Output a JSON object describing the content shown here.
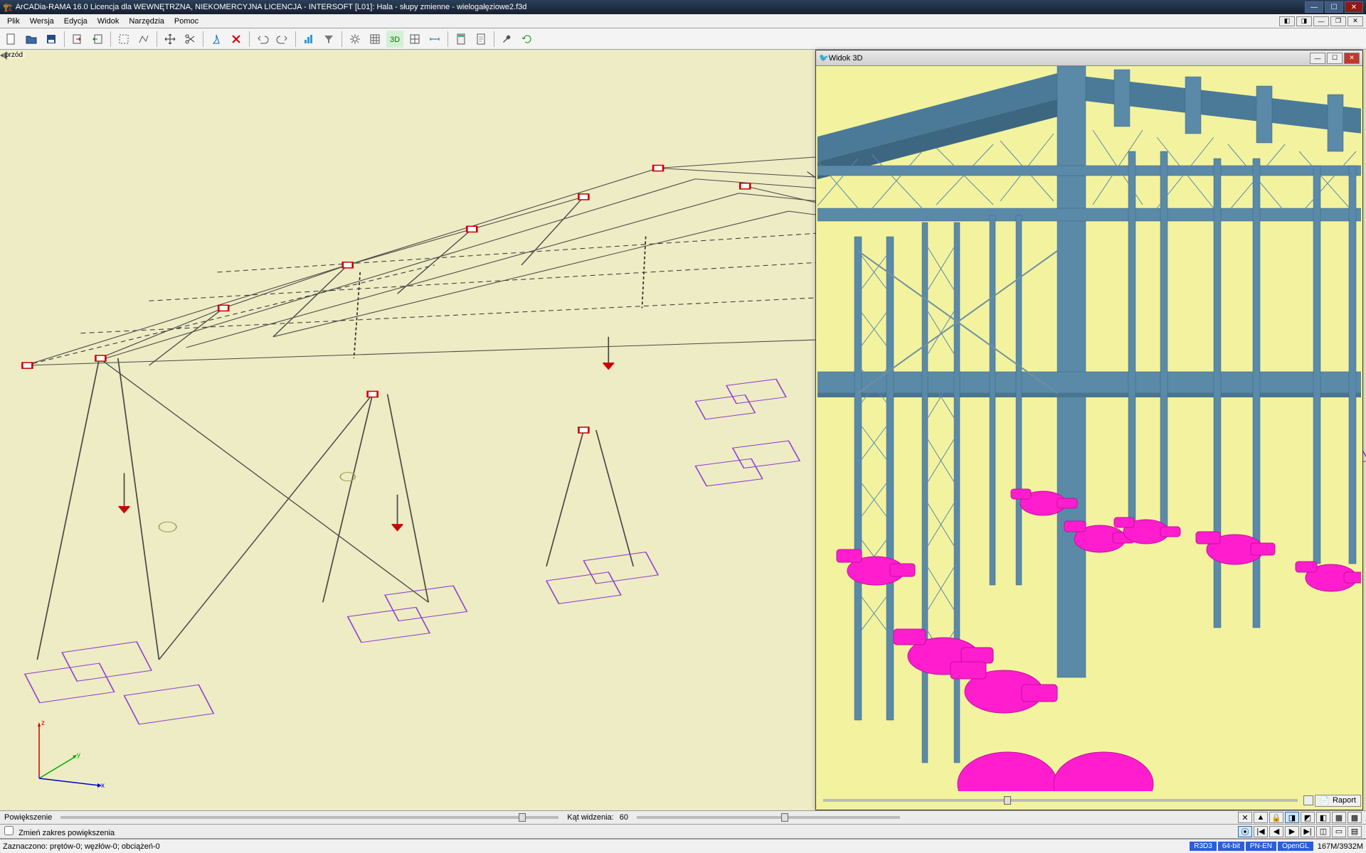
{
  "title": "ArCADia-RAMA 16.0 Licencja dla WEWNĘTRZNA, NIEKOMERCYJNA LICENCJA - INTERSOFT [L01]: Hala - słupy zmienne - wielogałęziowe2.f3d",
  "menu": {
    "items": [
      "Plik",
      "Wersja",
      "Edycja",
      "Widok",
      "Narzędzia",
      "Pomoc"
    ]
  },
  "toolbar_icons": [
    "new",
    "open",
    "save",
    "save-as",
    "import",
    "select-all",
    "fence",
    "move",
    "scissors",
    "anchor",
    "delete",
    "undo",
    "redo",
    "barchart",
    "funnel",
    "gear1",
    "table",
    "3d",
    "grid",
    "align",
    "calc",
    "doc",
    "wrench",
    "refresh"
  ],
  "view_label": "przód",
  "axis": {
    "z": "z",
    "y": "y",
    "x": "x"
  },
  "panel3d": {
    "title": "Widok 3D",
    "raport_label": "Raport"
  },
  "bottom": {
    "zoom_label": "Powiększenie",
    "angle_label": "Kąt widzenia:",
    "angle_value": "60",
    "checkbox_label": "Zmień zakres powiększenia"
  },
  "status": {
    "selection": "Zaznaczono: prętów-0; węzłów-0; obciążeń-0",
    "tags": [
      {
        "t": "R3D3",
        "c": "#2a5fd8"
      },
      {
        "t": "64-bit",
        "c": "#2a5fd8"
      },
      {
        "t": "PN-EN",
        "c": "#2a5fd8"
      },
      {
        "t": "OpenGL",
        "c": "#2a5fd8"
      }
    ],
    "memory": "167M/3932M"
  }
}
